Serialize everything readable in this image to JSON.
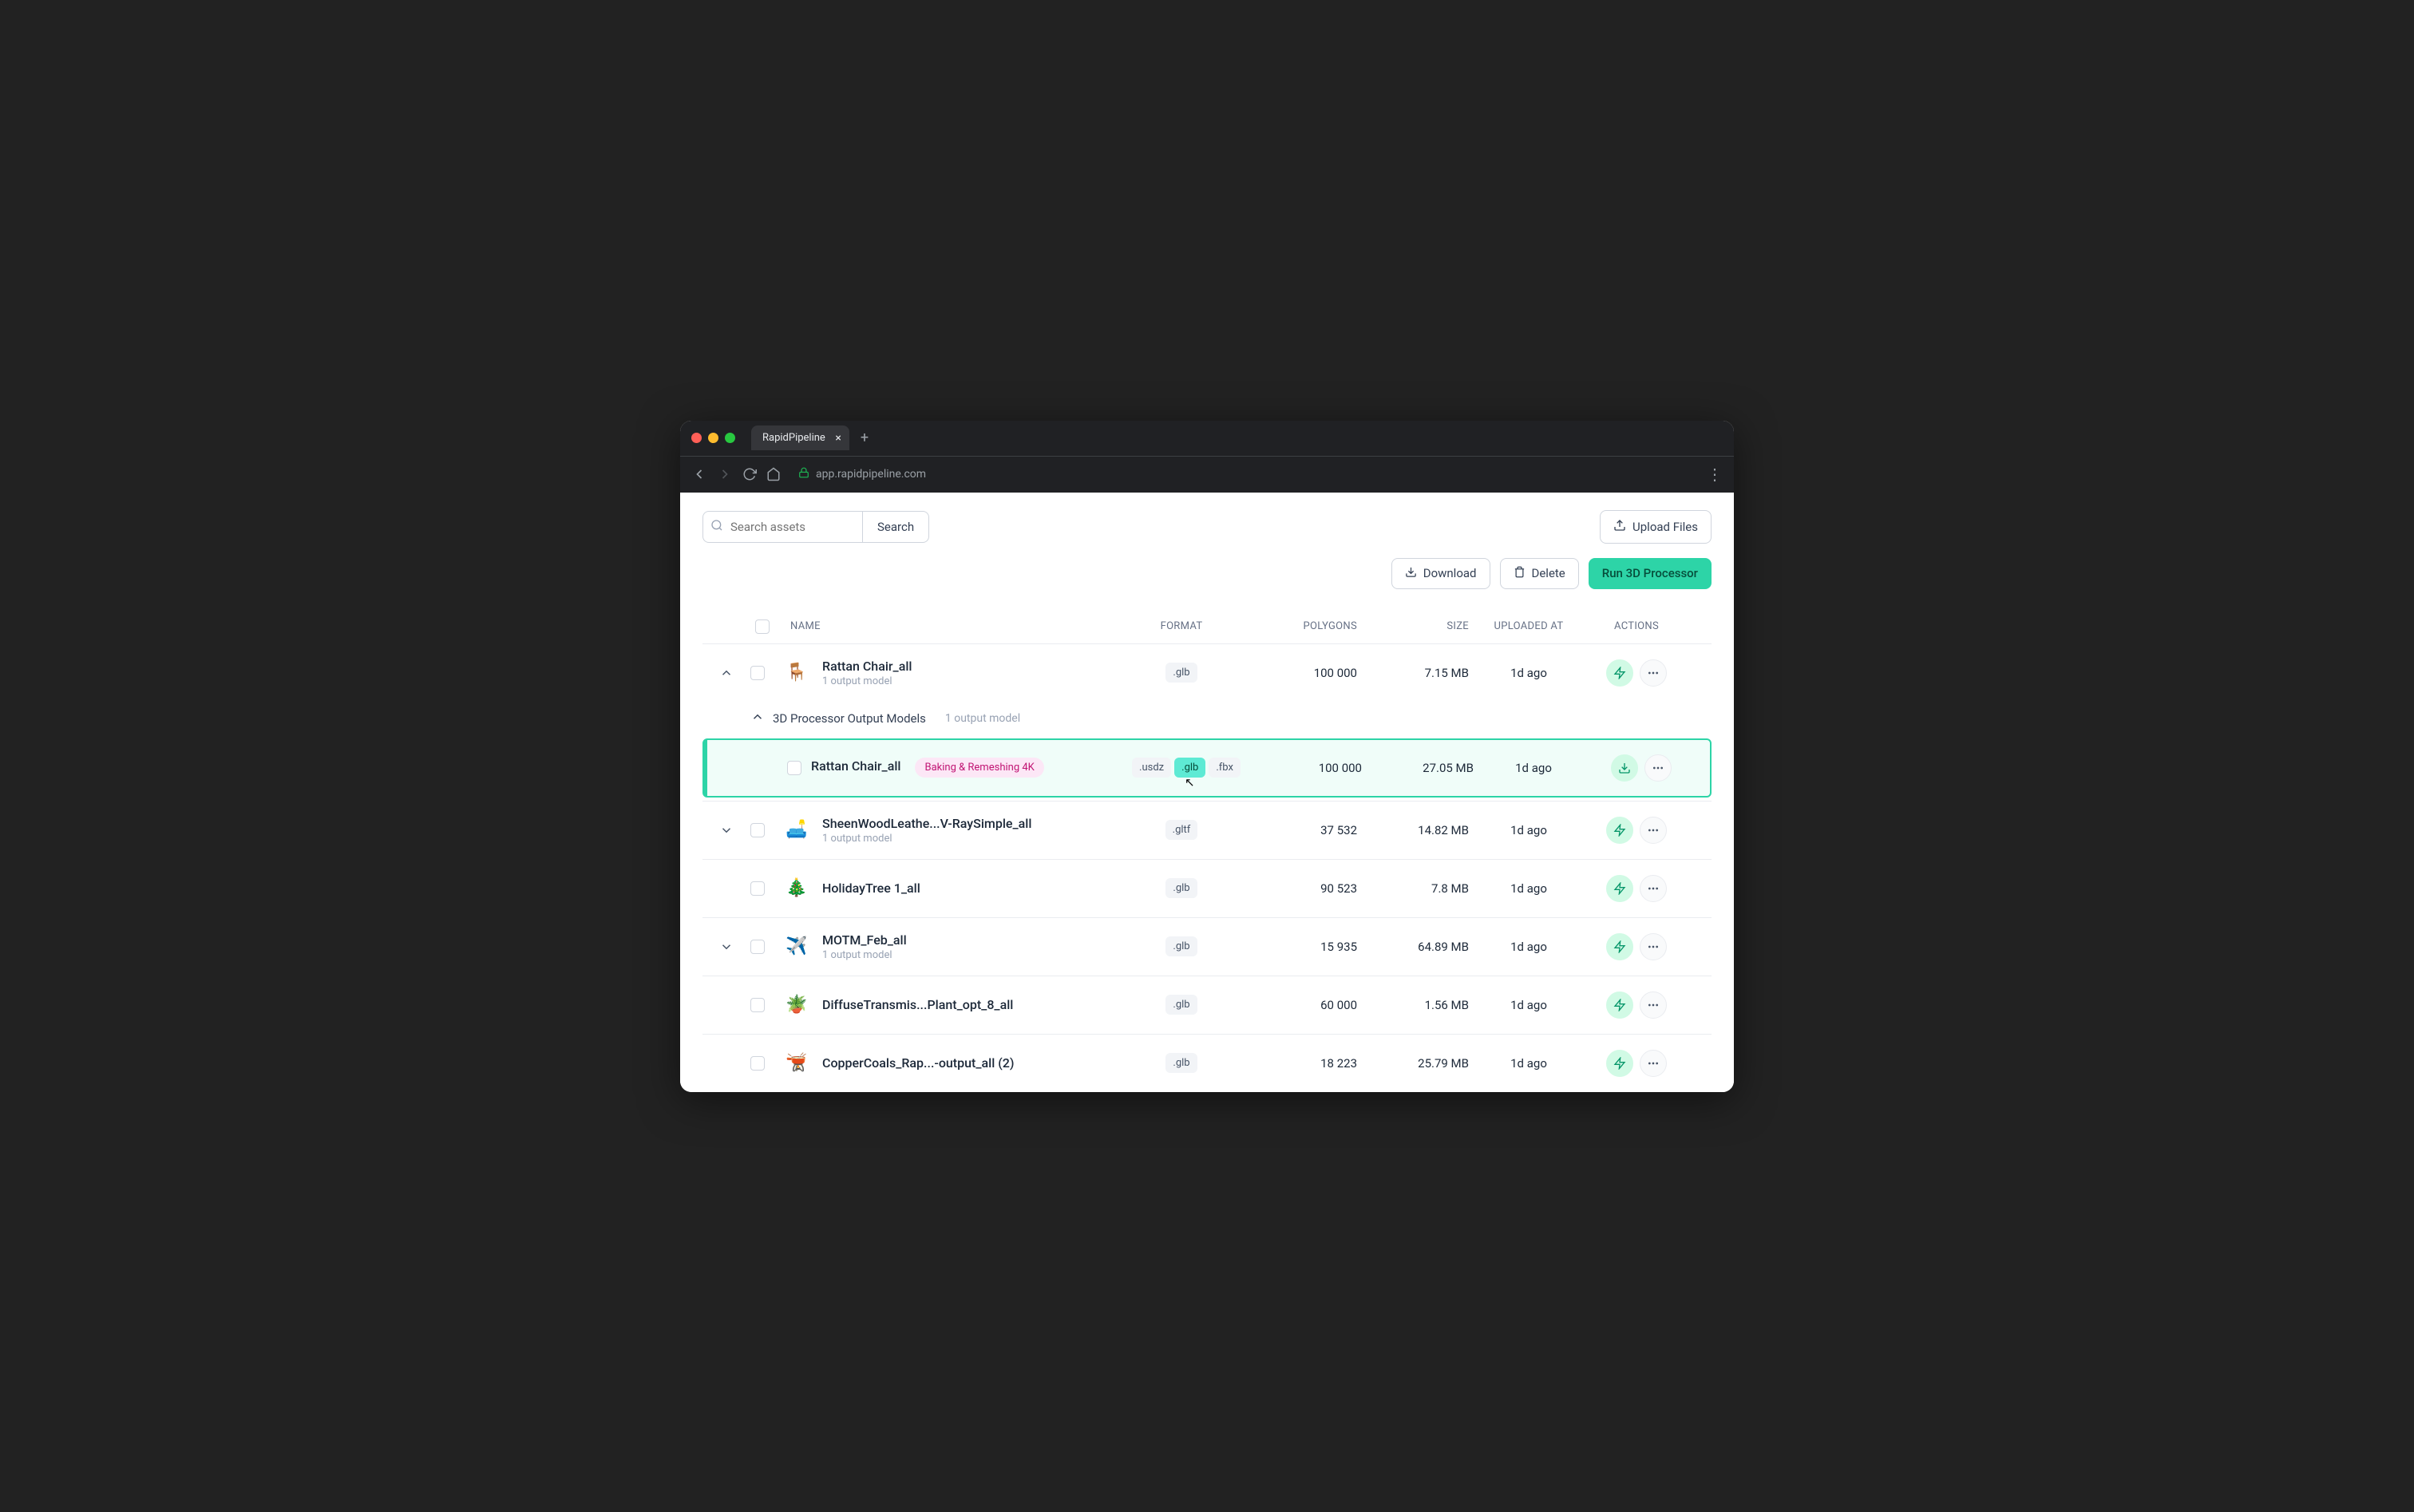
{
  "browser": {
    "tab_title": "RapidPipeline",
    "url": "app.rapidpipeline.com"
  },
  "topbar": {
    "search_placeholder": "Search assets",
    "search_button": "Search",
    "upload_button": "Upload Files"
  },
  "actions": {
    "download": "Download",
    "delete": "Delete",
    "run": "Run 3D Processor"
  },
  "columns": {
    "name": "NAME",
    "format": "FORMAT",
    "polygons": "POLYGONS",
    "size": "SIZE",
    "uploaded": "UPLOADED AT",
    "actions": "ACTIONS"
  },
  "output_section": {
    "title": "3D Processor Output Models",
    "count": "1 output model"
  },
  "rows": [
    {
      "id": "r0",
      "expanded": true,
      "thumb": "🪑",
      "name": "Rattan Chair_all",
      "subtitle": "1 output model",
      "formats": [
        ".glb"
      ],
      "polygons": "100 000",
      "size": "7.15 MB",
      "uploaded": "1d ago",
      "action_icon": "bolt"
    },
    {
      "id": "r0s",
      "is_sub": true,
      "name": "Rattan Chair_all",
      "badge": "Baking & Remeshing 4K",
      "formats": [
        ".usdz",
        ".glb",
        ".fbx"
      ],
      "active_format": ".glb",
      "polygons": "100 000",
      "size": "27.05 MB",
      "uploaded": "1d ago",
      "action_icon": "download"
    },
    {
      "id": "r1",
      "expandable": true,
      "thumb": "🛋️",
      "name": "SheenWoodLeathe...V-RaySimple_all",
      "subtitle": "1 output model",
      "formats": [
        ".gltf"
      ],
      "polygons": "37 532",
      "size": "14.82 MB",
      "uploaded": "1d ago",
      "action_icon": "bolt"
    },
    {
      "id": "r2",
      "thumb": "🎄",
      "name": "HolidayTree 1_all",
      "formats": [
        ".glb"
      ],
      "polygons": "90 523",
      "size": "7.8 MB",
      "uploaded": "1d ago",
      "action_icon": "bolt"
    },
    {
      "id": "r3",
      "expandable": true,
      "thumb": "✈️",
      "name": "MOTM_Feb_all",
      "subtitle": "1 output model",
      "formats": [
        ".glb"
      ],
      "polygons": "15 935",
      "size": "64.89 MB",
      "uploaded": "1d ago",
      "action_icon": "bolt"
    },
    {
      "id": "r4",
      "thumb": "🪴",
      "name": "DiffuseTransmis...Plant_opt_8_all",
      "formats": [
        ".glb"
      ],
      "polygons": "60 000",
      "size": "1.56 MB",
      "uploaded": "1d ago",
      "action_icon": "bolt"
    },
    {
      "id": "r5",
      "thumb": "🫕",
      "name": "CopperCoals_Rap...-output_all (2)",
      "formats": [
        ".glb"
      ],
      "polygons": "18 223",
      "size": "25.79 MB",
      "uploaded": "1d ago",
      "action_icon": "bolt"
    }
  ]
}
